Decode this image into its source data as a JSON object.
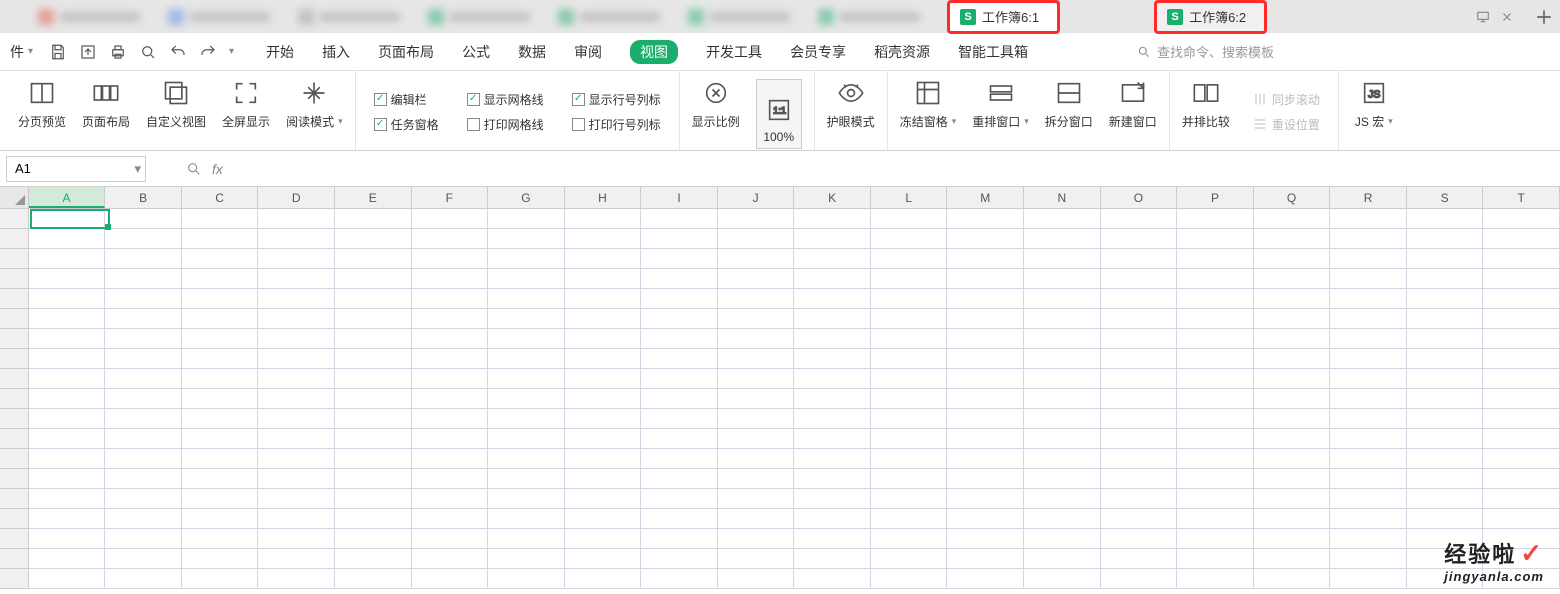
{
  "tabs": {
    "t1": "工作簿6:1",
    "t2": "工作簿6:2"
  },
  "file_btn": "件",
  "menu": {
    "start": "开始",
    "insert": "插入",
    "page": "页面布局",
    "formula": "公式",
    "data": "数据",
    "review": "审阅",
    "view": "视图",
    "dev": "开发工具",
    "member": "会员专享",
    "docer": "稻壳资源",
    "smart": "智能工具箱"
  },
  "search_ph": "查找命令、搜索模板",
  "toolbar": {
    "page_preview": "分页预览",
    "page_layout": "页面布局",
    "custom_view": "自定义视图",
    "fullscreen": "全屏显示",
    "read_mode": "阅读模式",
    "edit_bar": "编辑栏",
    "task_pane": "任务窗格",
    "show_grid": "显示网格线",
    "print_grid": "打印网格线",
    "show_headings": "显示行号列标",
    "print_headings": "打印行号列标",
    "zoom": "显示比例",
    "p100": "100%",
    "eye": "护眼模式",
    "freeze": "冻结窗格",
    "arrange": "重排窗口",
    "split": "拆分窗口",
    "new_win": "新建窗口",
    "side_by_side": "并排比较",
    "sync_scroll": "同步滚动",
    "reset_pos": "重设位置",
    "js": "JS 宏"
  },
  "name_box": "A1",
  "cols": [
    "A",
    "B",
    "C",
    "D",
    "E",
    "F",
    "G",
    "H",
    "I",
    "J",
    "K",
    "L",
    "M",
    "N",
    "O",
    "P",
    "Q",
    "R",
    "S",
    "T"
  ],
  "watermark": {
    "top": "经验啦",
    "bot": "jingyanla.com"
  }
}
